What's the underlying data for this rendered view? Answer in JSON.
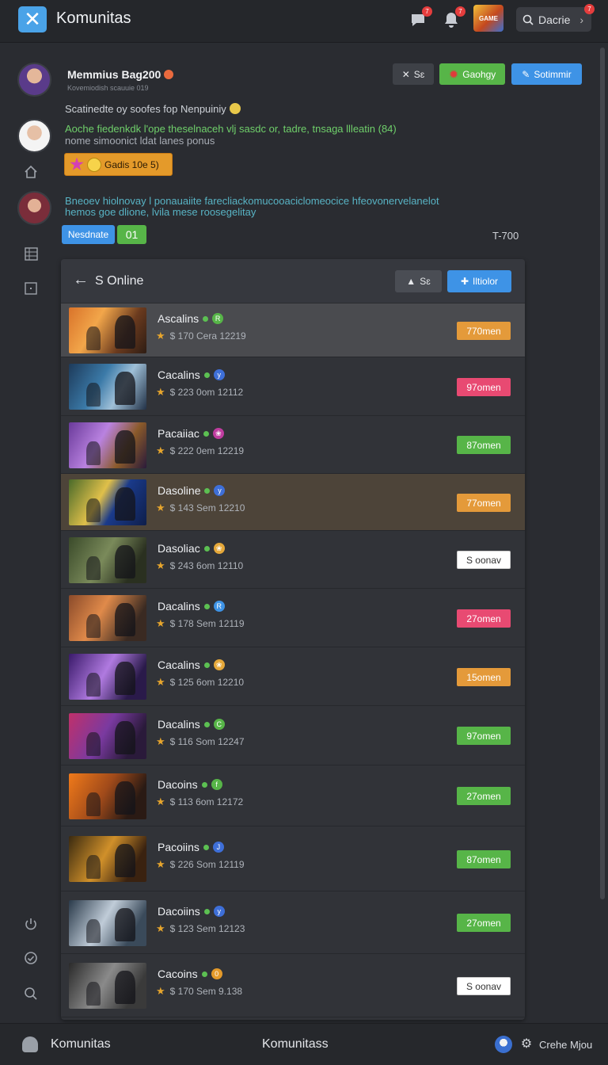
{
  "app": {
    "title": "Komunitas",
    "logo_glyph": "✕",
    "search_label": "Dacrie",
    "badges": {
      "chat": "7",
      "notif": "7",
      "search": "7"
    },
    "game_logo_text": "GAME"
  },
  "post": {
    "author": "Memmius Bag200",
    "subtitle": "Kovemiodish scauuie 019",
    "actions": {
      "close": "Sɛ",
      "green": "Gaohgy",
      "blue": "Sotimmir"
    },
    "line1": "Scatinedte oy soofes fop Nenpuiniy",
    "line2": "Aoche fiedenkdk  l'ope theselnaceh vlj sasdc or, tadre, tnsaga llleatin (84)",
    "line3": "nome simoonict  ldat lanes ponus",
    "gold_pill": "Gadis 10e 5)",
    "line4": "Bneoev hiolnovay  l ponauaiite farecliackomucooaciclomeocice hfeovonervelanelot",
    "line5": "hemos goe dlione,  lvila mese roosegelitay",
    "tag_blue": "Nesdnate",
    "tag_green": "01",
    "time": "T-700"
  },
  "panel": {
    "title": "S Online",
    "btn_secondary": "Sɛ",
    "btn_primary": "Iltiolor"
  },
  "rows": [
    {
      "name": "Ascalins",
      "meta": "$ 170 Cera 12219",
      "badge": "770men",
      "badge_color": "#e49a3a",
      "icon_color": "#57b548",
      "icon": "R"
    },
    {
      "name": "Cacalins",
      "meta": "$ 223 0om 12112",
      "badge": "97omen",
      "badge_color": "#e84a72",
      "icon_color": "#3e6fd8",
      "icon": "y"
    },
    {
      "name": "Pacaiiac",
      "meta": "$ 222 0em 12219",
      "badge": "87omen",
      "badge_color": "#57b548",
      "icon_color": "#c03da0",
      "icon": "❀"
    },
    {
      "name": "Dasoline",
      "meta": "$ 143 Sem 12210",
      "badge": "77omen",
      "badge_color": "#e49a3a",
      "icon_color": "#3e6fd8",
      "icon": "y"
    },
    {
      "name": "Dasoliac",
      "meta": "$ 243 6om 12110",
      "badge": "S oonav",
      "badge_color": "#ffffff",
      "icon_color": "#e5a83a",
      "icon": "❀"
    },
    {
      "name": "Dacalins",
      "meta": "$ 178 Sem 12119",
      "badge": "27omen",
      "badge_color": "#e84a72",
      "icon_color": "#3e93e6",
      "icon": "R"
    },
    {
      "name": "Cacalins",
      "meta": "$ 125 6om 12210",
      "badge": "15omen",
      "badge_color": "#e49a3a",
      "icon_color": "#e5a83a",
      "icon": "❀"
    },
    {
      "name": "Dacalins",
      "meta": "$ 116 Som 12247",
      "badge": "97omen",
      "badge_color": "#57b548",
      "icon_color": "#57b548",
      "icon": "C"
    },
    {
      "name": "Dacoins",
      "meta": "$ 113 6om 12172",
      "badge": "27omen",
      "badge_color": "#57b548",
      "icon_color": "#57b548",
      "icon": "f"
    },
    {
      "name": "Pacoiins",
      "meta": "$ 226 Som 12119",
      "badge": "87omen",
      "badge_color": "#57b548",
      "icon_color": "#3e6fd8",
      "icon": "J"
    },
    {
      "name": "Dacoiins",
      "meta": "$ 123 Sem 12123",
      "badge": "27omen",
      "badge_color": "#57b548",
      "icon_color": "#3e6fd8",
      "icon": "y"
    },
    {
      "name": "Cacoins",
      "meta": "$ 170 Sem 9.138",
      "badge": "S oonav",
      "badge_color": "#ffffff",
      "icon_color": "#e49a2a",
      "icon": "0"
    }
  ],
  "bottom": {
    "left": "Komunitas",
    "center": "Komunitass",
    "right": "Crehe Mjou"
  }
}
